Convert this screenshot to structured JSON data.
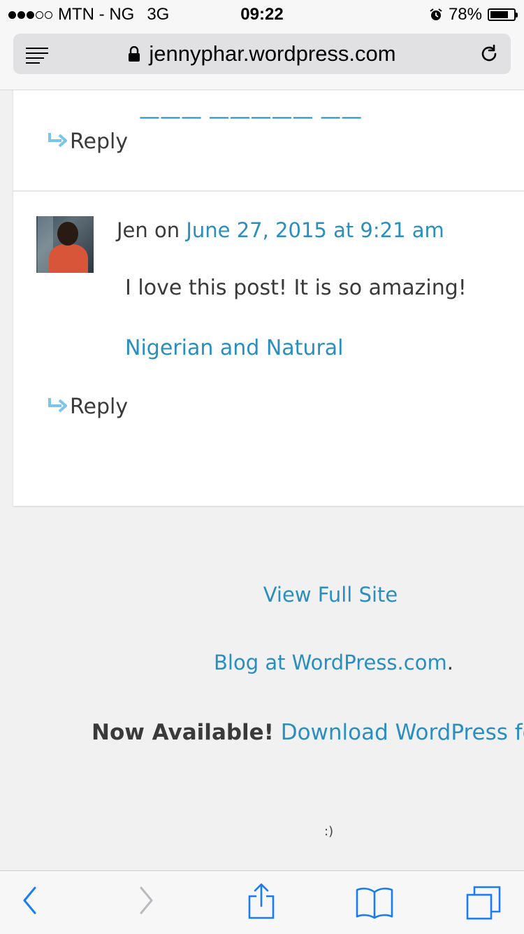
{
  "status_bar": {
    "carrier": "MTN - NG",
    "network": "3G",
    "time": "09:22",
    "battery_percent": "78%",
    "battery_level": 0.78
  },
  "browser": {
    "url": "jennyphar.wordpress.com"
  },
  "comments": {
    "previous_reply_label": "Reply",
    "author": "Jen",
    "on_word": "on",
    "date": "June 27, 2015 at 9:21 am",
    "text": "I love this post! It is so amazing!",
    "link": "Nigerian and Natural",
    "reply_label": "Reply"
  },
  "footer": {
    "view_full_site": "View Full Site",
    "blog_at": "Blog at WordPress.com",
    "blog_at_suffix": ".",
    "now_available": "Now Available!",
    "download_link": "Download WordPress for",
    "smiley": ":)"
  },
  "colors": {
    "link": "#2a8ebf",
    "text": "#3a3a3a",
    "ios_blue": "#1a7cf5"
  }
}
